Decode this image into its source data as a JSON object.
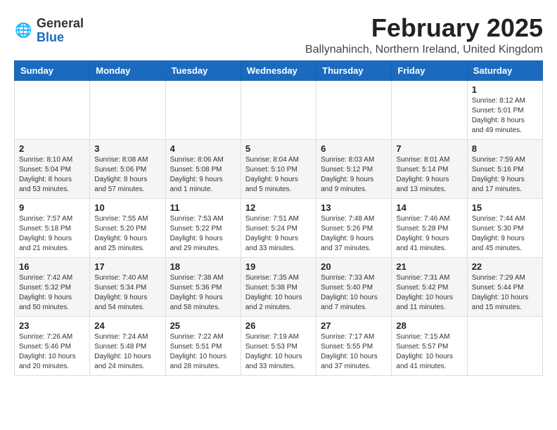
{
  "logo": {
    "general": "General",
    "blue": "Blue"
  },
  "header": {
    "month_title": "February 2025",
    "location": "Ballynahinch, Northern Ireland, United Kingdom"
  },
  "weekdays": [
    "Sunday",
    "Monday",
    "Tuesday",
    "Wednesday",
    "Thursday",
    "Friday",
    "Saturday"
  ],
  "weeks": [
    [
      {
        "day": "",
        "info": ""
      },
      {
        "day": "",
        "info": ""
      },
      {
        "day": "",
        "info": ""
      },
      {
        "day": "",
        "info": ""
      },
      {
        "day": "",
        "info": ""
      },
      {
        "day": "",
        "info": ""
      },
      {
        "day": "1",
        "info": "Sunrise: 8:12 AM\nSunset: 5:01 PM\nDaylight: 8 hours and 49 minutes."
      }
    ],
    [
      {
        "day": "2",
        "info": "Sunrise: 8:10 AM\nSunset: 5:04 PM\nDaylight: 8 hours and 53 minutes."
      },
      {
        "day": "3",
        "info": "Sunrise: 8:08 AM\nSunset: 5:06 PM\nDaylight: 8 hours and 57 minutes."
      },
      {
        "day": "4",
        "info": "Sunrise: 8:06 AM\nSunset: 5:08 PM\nDaylight: 9 hours and 1 minute."
      },
      {
        "day": "5",
        "info": "Sunrise: 8:04 AM\nSunset: 5:10 PM\nDaylight: 9 hours and 5 minutes."
      },
      {
        "day": "6",
        "info": "Sunrise: 8:03 AM\nSunset: 5:12 PM\nDaylight: 9 hours and 9 minutes."
      },
      {
        "day": "7",
        "info": "Sunrise: 8:01 AM\nSunset: 5:14 PM\nDaylight: 9 hours and 13 minutes."
      },
      {
        "day": "8",
        "info": "Sunrise: 7:59 AM\nSunset: 5:16 PM\nDaylight: 9 hours and 17 minutes."
      }
    ],
    [
      {
        "day": "9",
        "info": "Sunrise: 7:57 AM\nSunset: 5:18 PM\nDaylight: 9 hours and 21 minutes."
      },
      {
        "day": "10",
        "info": "Sunrise: 7:55 AM\nSunset: 5:20 PM\nDaylight: 9 hours and 25 minutes."
      },
      {
        "day": "11",
        "info": "Sunrise: 7:53 AM\nSunset: 5:22 PM\nDaylight: 9 hours and 29 minutes."
      },
      {
        "day": "12",
        "info": "Sunrise: 7:51 AM\nSunset: 5:24 PM\nDaylight: 9 hours and 33 minutes."
      },
      {
        "day": "13",
        "info": "Sunrise: 7:48 AM\nSunset: 5:26 PM\nDaylight: 9 hours and 37 minutes."
      },
      {
        "day": "14",
        "info": "Sunrise: 7:46 AM\nSunset: 5:28 PM\nDaylight: 9 hours and 41 minutes."
      },
      {
        "day": "15",
        "info": "Sunrise: 7:44 AM\nSunset: 5:30 PM\nDaylight: 9 hours and 45 minutes."
      }
    ],
    [
      {
        "day": "16",
        "info": "Sunrise: 7:42 AM\nSunset: 5:32 PM\nDaylight: 9 hours and 50 minutes."
      },
      {
        "day": "17",
        "info": "Sunrise: 7:40 AM\nSunset: 5:34 PM\nDaylight: 9 hours and 54 minutes."
      },
      {
        "day": "18",
        "info": "Sunrise: 7:38 AM\nSunset: 5:36 PM\nDaylight: 9 hours and 58 minutes."
      },
      {
        "day": "19",
        "info": "Sunrise: 7:35 AM\nSunset: 5:38 PM\nDaylight: 10 hours and 2 minutes."
      },
      {
        "day": "20",
        "info": "Sunrise: 7:33 AM\nSunset: 5:40 PM\nDaylight: 10 hours and 7 minutes."
      },
      {
        "day": "21",
        "info": "Sunrise: 7:31 AM\nSunset: 5:42 PM\nDaylight: 10 hours and 11 minutes."
      },
      {
        "day": "22",
        "info": "Sunrise: 7:29 AM\nSunset: 5:44 PM\nDaylight: 10 hours and 15 minutes."
      }
    ],
    [
      {
        "day": "23",
        "info": "Sunrise: 7:26 AM\nSunset: 5:46 PM\nDaylight: 10 hours and 20 minutes."
      },
      {
        "day": "24",
        "info": "Sunrise: 7:24 AM\nSunset: 5:48 PM\nDaylight: 10 hours and 24 minutes."
      },
      {
        "day": "25",
        "info": "Sunrise: 7:22 AM\nSunset: 5:51 PM\nDaylight: 10 hours and 28 minutes."
      },
      {
        "day": "26",
        "info": "Sunrise: 7:19 AM\nSunset: 5:53 PM\nDaylight: 10 hours and 33 minutes."
      },
      {
        "day": "27",
        "info": "Sunrise: 7:17 AM\nSunset: 5:55 PM\nDaylight: 10 hours and 37 minutes."
      },
      {
        "day": "28",
        "info": "Sunrise: 7:15 AM\nSunset: 5:57 PM\nDaylight: 10 hours and 41 minutes."
      },
      {
        "day": "",
        "info": ""
      }
    ]
  ]
}
